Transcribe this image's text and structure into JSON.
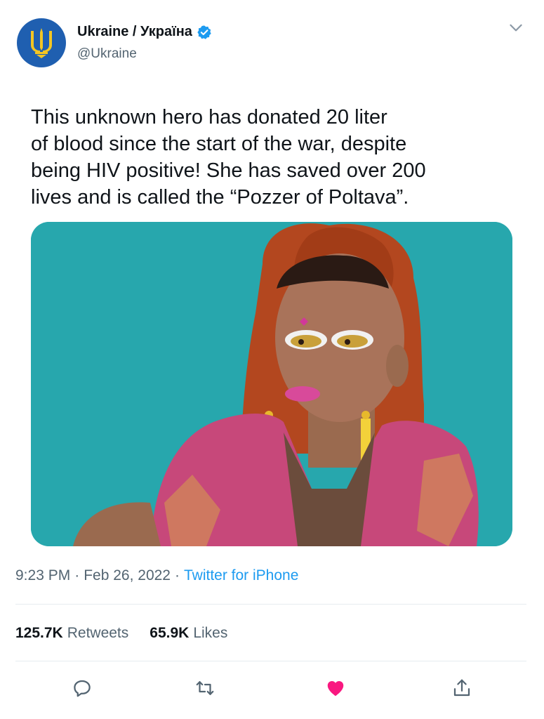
{
  "account": {
    "display_name": "Ukraine / Україна",
    "handle": "@Ukraine",
    "verified": true,
    "avatar_icon": "trident-coat-of-arms-icon"
  },
  "tweet": {
    "text_lines": [
      "This unknown hero has donated 20 liter",
      "of blood since the start of the war, despite",
      "being HIV positive! She has saved over 200",
      "lives and is called the “Pozzer of Poltava”."
    ],
    "media_icon": "portrait-photo"
  },
  "meta": {
    "time": "9:23 PM",
    "separator": "·",
    "date": "Feb 26, 2022",
    "source": "Twitter for iPhone"
  },
  "stats": {
    "retweets_count": "125.7K",
    "retweets_label": "Retweets",
    "likes_count": "65.9K",
    "likes_label": "Likes"
  },
  "actions": [
    {
      "name": "reply",
      "icon": "reply-icon"
    },
    {
      "name": "retweet",
      "icon": "retweet-icon"
    },
    {
      "name": "like",
      "icon": "heart-icon",
      "liked": true
    },
    {
      "name": "share",
      "icon": "share-icon"
    }
  ],
  "colors": {
    "accent": "#1d9bf0",
    "like": "#f91880",
    "avatar_bg": "#1f5fb0",
    "trident": "#f3c623",
    "media_bg": "#27a7ad"
  }
}
